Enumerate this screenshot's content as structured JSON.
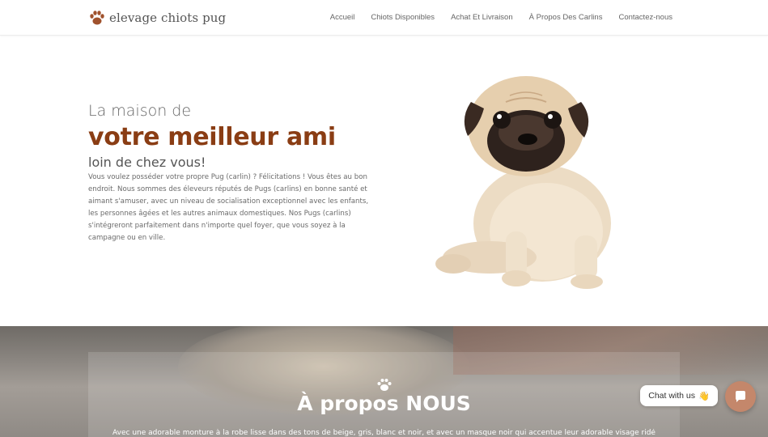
{
  "header": {
    "logo_text": "elevage chiots pug",
    "nav": [
      "Accueil",
      "Chiots Disponibles",
      "Achat Et Livraison",
      "À Propos Des Carlins",
      "Contactez-nous"
    ]
  },
  "hero": {
    "line1": "La maison de",
    "title": "votre meilleur ami",
    "line3": "loin de chez vous!",
    "body": "Vous voulez posséder votre propre Pug (carlin) ? Félicitations ! Vous êtes au bon endroit. Nous sommes des éleveurs réputés de Pugs (carlins) en bonne santé et aimant s'amuser, avec un niveau de socialisation exceptionnel avec les enfants, les personnes âgées et les autres animaux domestiques. Nos Pugs (carlins) s'intégreront parfaitement dans n'importe quel foyer, que vous soyez à la campagne ou en ville."
  },
  "about": {
    "title": "À propos NOUS",
    "text": "Avec une adorable monture à la robe lisse dans des tons de beige, gris, blanc et noir, et avec un masque noir qui accentue leur adorable visage ridé"
  },
  "chat": {
    "label": "Chat with us",
    "emoji": "👋"
  },
  "colors": {
    "accent": "#8a3d14",
    "chat_button": "#c4876b"
  },
  "icons": [
    "paw-logo-icon",
    "paw-icon",
    "chat-icon"
  ]
}
